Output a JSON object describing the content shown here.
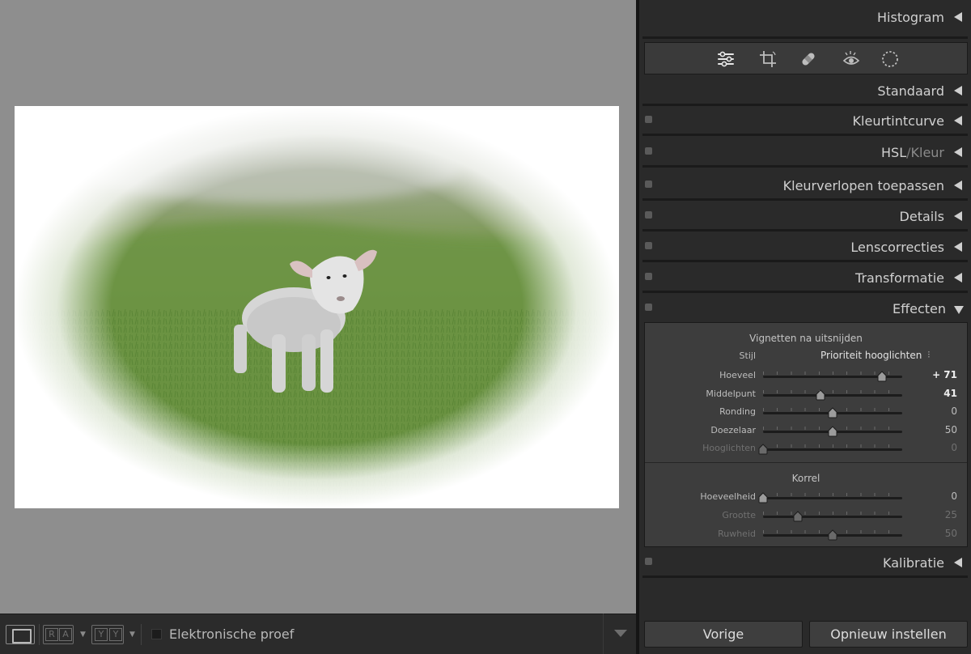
{
  "toolbar": {
    "view_modes": [
      {
        "name": "loupe"
      },
      {
        "name": "before-after-ra",
        "letters": [
          "R",
          "A"
        ]
      },
      {
        "name": "before-after-yy",
        "letters": [
          "Y",
          "Y"
        ]
      }
    ],
    "soft_proof_label": "Elektronische proef",
    "soft_proof_checked": false
  },
  "panel": {
    "sections": {
      "histogram": "Histogram",
      "standaard": "Standaard",
      "kleurtintcurve": "Kleurtintcurve",
      "hsl": "HSL",
      "hsl_sep": "/",
      "hsl_kleur": "Kleur",
      "kleurverlopen": "Kleurverlopen toepassen",
      "details": "Details",
      "lenscorrecties": "Lenscorrecties",
      "transformatie": "Transformatie",
      "effecten": "Effecten",
      "kalibratie": "Kalibratie"
    },
    "tools": [
      "sliders-icon",
      "crop-icon",
      "healing-icon",
      "redeye-icon",
      "mask-icon"
    ],
    "effects": {
      "vignette_title": "Vignetten na uitsnijden",
      "style_label": "Stijl",
      "style_value": "Prioriteit hooglichten",
      "vignette_sliders": [
        {
          "label": "Hoeveel",
          "value": "+ 71",
          "position": 0.855,
          "strong": true,
          "dim": false
        },
        {
          "label": "Middelpunt",
          "value": "41",
          "position": 0.41,
          "strong": true,
          "dim": false
        },
        {
          "label": "Ronding",
          "value": "0",
          "position": 0.5,
          "strong": false,
          "dim": false
        },
        {
          "label": "Doezelaar",
          "value": "50",
          "position": 0.5,
          "strong": false,
          "dim": false
        },
        {
          "label": "Hooglichten",
          "value": "0",
          "position": 0.0,
          "strong": false,
          "dim": true
        }
      ],
      "grain_title": "Korrel",
      "grain_sliders": [
        {
          "label": "Hoeveelheid",
          "value": "0",
          "position": 0.0,
          "strong": false,
          "dim": false
        },
        {
          "label": "Grootte",
          "value": "25",
          "position": 0.25,
          "strong": false,
          "dim": true
        },
        {
          "label": "Ruwheid",
          "value": "50",
          "position": 0.5,
          "strong": false,
          "dim": true
        }
      ]
    },
    "buttons": {
      "previous": "Vorige",
      "reset": "Opnieuw instellen"
    }
  }
}
